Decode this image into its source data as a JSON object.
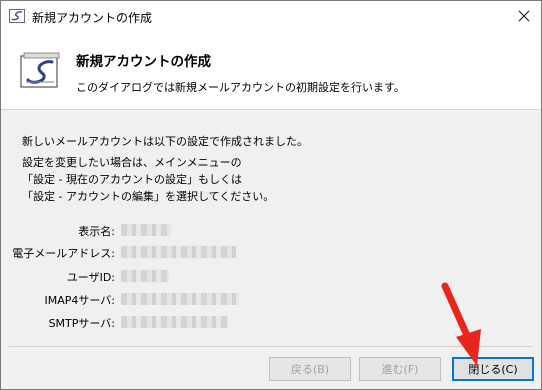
{
  "window": {
    "title": "新規アカウントの作成",
    "app_icon": "app-logo-icon",
    "close_glyph": "✕"
  },
  "header": {
    "title": "新規アカウントの作成",
    "description": "このダイアログでは新規メールアカウントの初期設定を行います。"
  },
  "message": {
    "line1": "新しいメールアカウントは以下の設定で作成されました。",
    "line2": "設定を変更したい場合は、メインメニューの",
    "line3": "「設定 - 現在のアカウントの設定」もしくは",
    "line4": "「設定 - アカウントの編集」を選択してください。"
  },
  "fields": {
    "display_name": "表示名:",
    "email": "電子メールアドレス:",
    "user_id": "ユーザID:",
    "imap": "IMAP4サーバ:",
    "smtp": "SMTPサーバ:"
  },
  "buttons": {
    "back": "戻る(B)",
    "next": "進む(F)",
    "close": "閉じる(C)"
  },
  "colors": {
    "accent": "#0078d7",
    "annotation_arrow": "#e8261c"
  }
}
